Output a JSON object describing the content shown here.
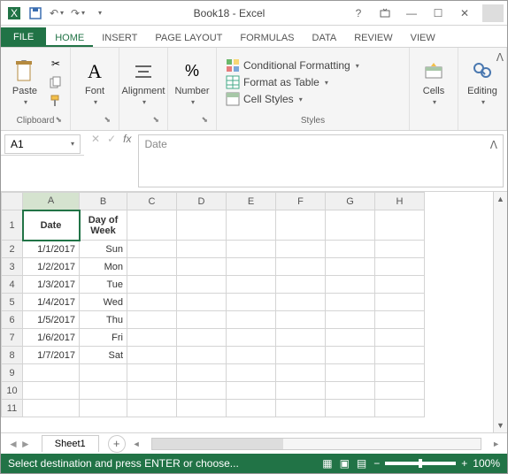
{
  "title": "Book18 - Excel",
  "tabs": {
    "file": "FILE",
    "home": "HOME",
    "insert": "INSERT",
    "pagelayout": "PAGE LAYOUT",
    "formulas": "FORMULAS",
    "data": "DATA",
    "review": "REVIEW",
    "view": "VIEW"
  },
  "ribbon": {
    "clipboard": {
      "paste": "Paste",
      "label": "Clipboard"
    },
    "font": {
      "btn": "Font",
      "label": ""
    },
    "alignment": {
      "btn": "Alignment",
      "label": ""
    },
    "number": {
      "btn": "Number",
      "label": ""
    },
    "styles": {
      "cond": "Conditional Formatting",
      "table": "Format as Table",
      "cell": "Cell Styles",
      "label": "Styles"
    },
    "cells": {
      "btn": "Cells",
      "label": ""
    },
    "editing": {
      "btn": "Editing",
      "label": ""
    }
  },
  "nameBox": "A1",
  "formulaValue": "Date",
  "columns": [
    "A",
    "B",
    "C",
    "D",
    "E",
    "F",
    "G",
    "H"
  ],
  "rows": [
    "1",
    "2",
    "3",
    "4",
    "5",
    "6",
    "7",
    "8",
    "9",
    "10",
    "11"
  ],
  "headers": {
    "A": "Date",
    "B": "Day of Week"
  },
  "cellData": [
    {
      "A": "1/1/2017",
      "B": "Sun"
    },
    {
      "A": "1/2/2017",
      "B": "Mon"
    },
    {
      "A": "1/3/2017",
      "B": "Tue"
    },
    {
      "A": "1/4/2017",
      "B": "Wed"
    },
    {
      "A": "1/5/2017",
      "B": "Thu"
    },
    {
      "A": "1/6/2017",
      "B": "Fri"
    },
    {
      "A": "1/7/2017",
      "B": "Sat"
    }
  ],
  "sheetName": "Sheet1",
  "status": "Select destination and press ENTER or choose...",
  "zoom": "100%"
}
